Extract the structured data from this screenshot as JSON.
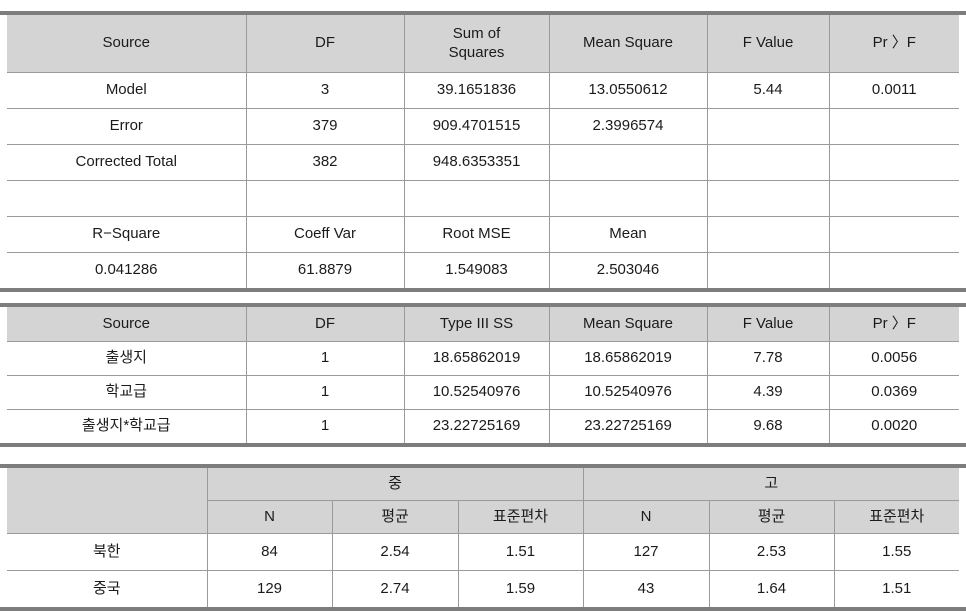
{
  "tables": [
    {
      "id": "anova-overall",
      "columns": [
        "Source",
        "DF",
        "Sum of Squares",
        "Mean Square",
        "F Value",
        "Pr 〉F"
      ],
      "header_lines": {
        "c0": "Source",
        "c1": "DF",
        "c2_line1": "Sum of",
        "c2_line2": "Squares",
        "c3": "Mean Square",
        "c4": "F Value",
        "c5": "Pr 〉F"
      },
      "rows": [
        [
          "Model",
          "3",
          "39.1651836",
          "13.0550612",
          "5.44",
          "0.0011"
        ],
        [
          "Error",
          "379",
          "909.4701515",
          "2.3996574",
          "",
          ""
        ],
        [
          "Corrected  Total",
          "382",
          "948.6353351",
          "",
          "",
          ""
        ],
        [
          "",
          "",
          "",
          "",
          "",
          ""
        ]
      ],
      "fit_header": [
        "R−Square",
        "Coeff Var",
        "Root MSE",
        "Mean",
        "",
        ""
      ],
      "fit_values": [
        "0.041286",
        "61.8879",
        "1.549083",
        "2.503046",
        "",
        ""
      ]
    },
    {
      "id": "type3-effects",
      "header_lines": {
        "c0": "Source",
        "c1": "DF",
        "c2": "Type III SS",
        "c3": "Mean Square",
        "c4": "F Value",
        "c5": "Pr 〉F"
      },
      "rows": [
        [
          "출생지",
          "1",
          "18.65862019",
          "18.65862019",
          "7.78",
          "0.0056"
        ],
        [
          "학교급",
          "1",
          "10.52540976",
          "10.52540976",
          "4.39",
          "0.0369"
        ],
        [
          "출생지*학교급",
          "1",
          "23.22725169",
          "23.22725169",
          "9.68",
          "0.0020"
        ]
      ]
    },
    {
      "id": "descriptives-by-schoollevel",
      "corner": "",
      "groups": [
        "중",
        "고"
      ],
      "sub_headers": [
        "N",
        "평균",
        "표준편차"
      ],
      "rows": [
        {
          "label": "북한",
          "mid": [
            "84",
            "2.54",
            "1.51"
          ],
          "high": [
            "127",
            "2.53",
            "1.55"
          ]
        },
        {
          "label": "중국",
          "mid": [
            "129",
            "2.74",
            "1.59"
          ],
          "high": [
            "43",
            "1.64",
            "1.51"
          ]
        }
      ]
    }
  ],
  "colors": {
    "header_fill": "#d4d4d4",
    "rule_heavy": "#7d7d7d",
    "grid_line": "#9a9a9a",
    "text": "#1b1b1b",
    "page_background": "#ffffff"
  }
}
